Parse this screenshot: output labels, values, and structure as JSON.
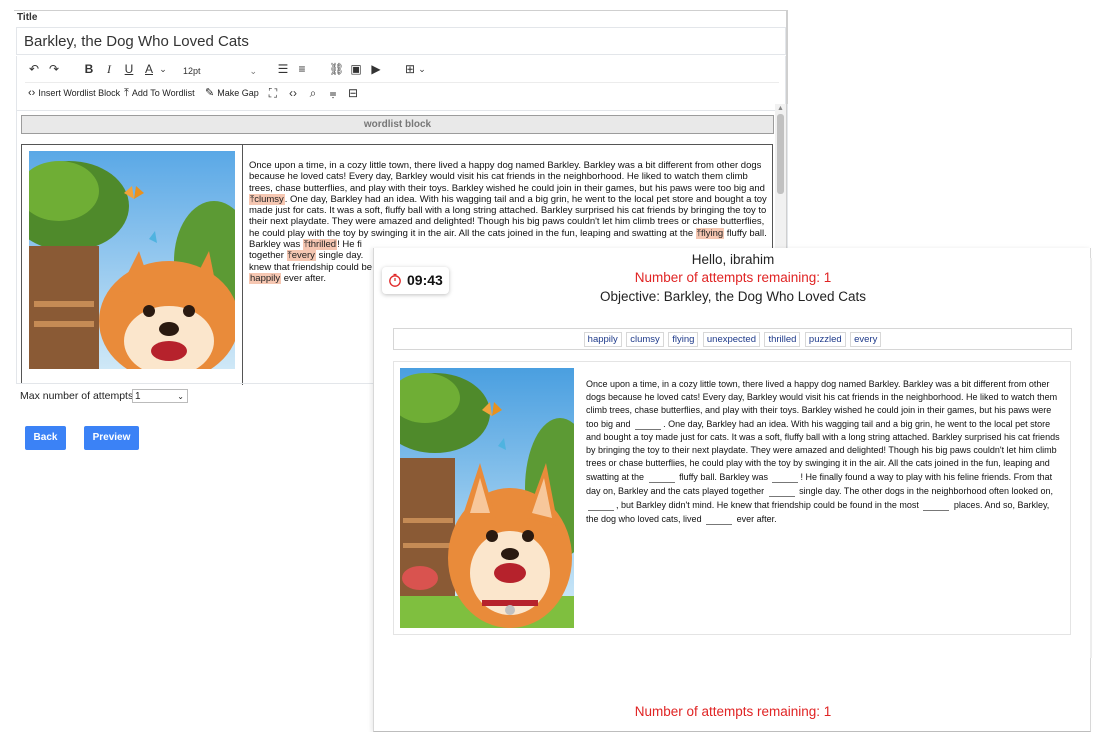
{
  "editor": {
    "title_label": "Title",
    "title_value": "Barkley, the Dog Who Loved Cats",
    "toolbar": {
      "font_size": "12pt",
      "insert_wordlist_block": "Insert Wordlist Block",
      "add_to_wordlist": "Add To Wordlist",
      "make_gap": "Make Gap"
    },
    "wordlist_block_label": "wordlist block",
    "story_segments": [
      "Once upon a time, in a cozy little town, there lived a happy dog named Barkley. Barkley was a bit different from other dogs because he loved cats! Every day, Barkley would visit his cat friends in the neighborhood. He liked to watch them climb trees, chase butterflies, and play with their toys. Barkley wished he could join in their games, but his paws were too big and ",
      ". One day, Barkley had an idea. With his wagging tail and a big grin, he went to the local pet store and bought a toy made just for cats. It was a soft, fluffy ball with a long string attached. Barkley surprised his cat friends by bringing the toy to their next playdate. They were amazed and delighted! Though his big paws couldn't let him climb trees or chase butterflies, he could play with the toy by swinging it in the air. All the cats joined in the fun, leaping and swatting at the ",
      " fluffy ball. Barkley was ",
      "! He fi",
      "together ",
      " single day. ",
      "knew that friendship could be f",
      " ever after."
    ],
    "gap_words": [
      "clumsy",
      "flying",
      "thrilled",
      "every",
      "happily"
    ],
    "max_attempts_label": "Max number of attempts:",
    "max_attempts_value": "1",
    "back_button": "Back",
    "preview_button": "Preview"
  },
  "timer": {
    "time": "09:43"
  },
  "preview": {
    "greeting": "Hello, ibrahim",
    "attempts_remaining": "Number of attempts remaining: 1",
    "objective": "Objective: Barkley, the Dog Who Loved Cats",
    "word_bank": [
      "happily",
      "clumsy",
      "flying",
      "unexpected",
      "thrilled",
      "puzzled",
      "every"
    ],
    "story_segments": [
      "Once upon a time, in a cozy little town, there lived a happy dog named Barkley. Barkley was a bit different from other dogs because he loved cats! Every day, Barkley would visit his cat friends in the neighborhood. He liked to watch them climb trees, chase butterflies, and play with their toys. Barkley wished he could join in their games, but his paws were too big and",
      ". One day, Barkley had an idea. With his wagging tail and a big grin, he went to the local pet store and bought a toy made just for cats. It was a soft, fluffy ball with a long string attached. Barkley surprised his cat friends by bringing the toy to their next playdate. They were amazed and delighted! Though his big paws couldn't let him climb trees or chase butterflies, he could play with the toy by swinging it in the air. All the cats joined in the fun, leaping and swatting at the",
      "fluffy ball. Barkley was",
      "! He finally found a way to play with his feline friends. From that day on, Barkley and the cats played together",
      "single day. The other dogs in the neighborhood often looked on,",
      ", but Barkley didn't mind. He knew that friendship could be found in the most",
      "places. And so, Barkley, the dog who loved cats, lived",
      "ever after."
    ],
    "attempts_remaining_bottom": "Number of attempts remaining: 1"
  },
  "colors": {
    "accent_blue": "#3b82f6",
    "error_red": "#e02424",
    "gap_highlight": "#f6c7b2",
    "word_text": "#1e3a8a"
  }
}
